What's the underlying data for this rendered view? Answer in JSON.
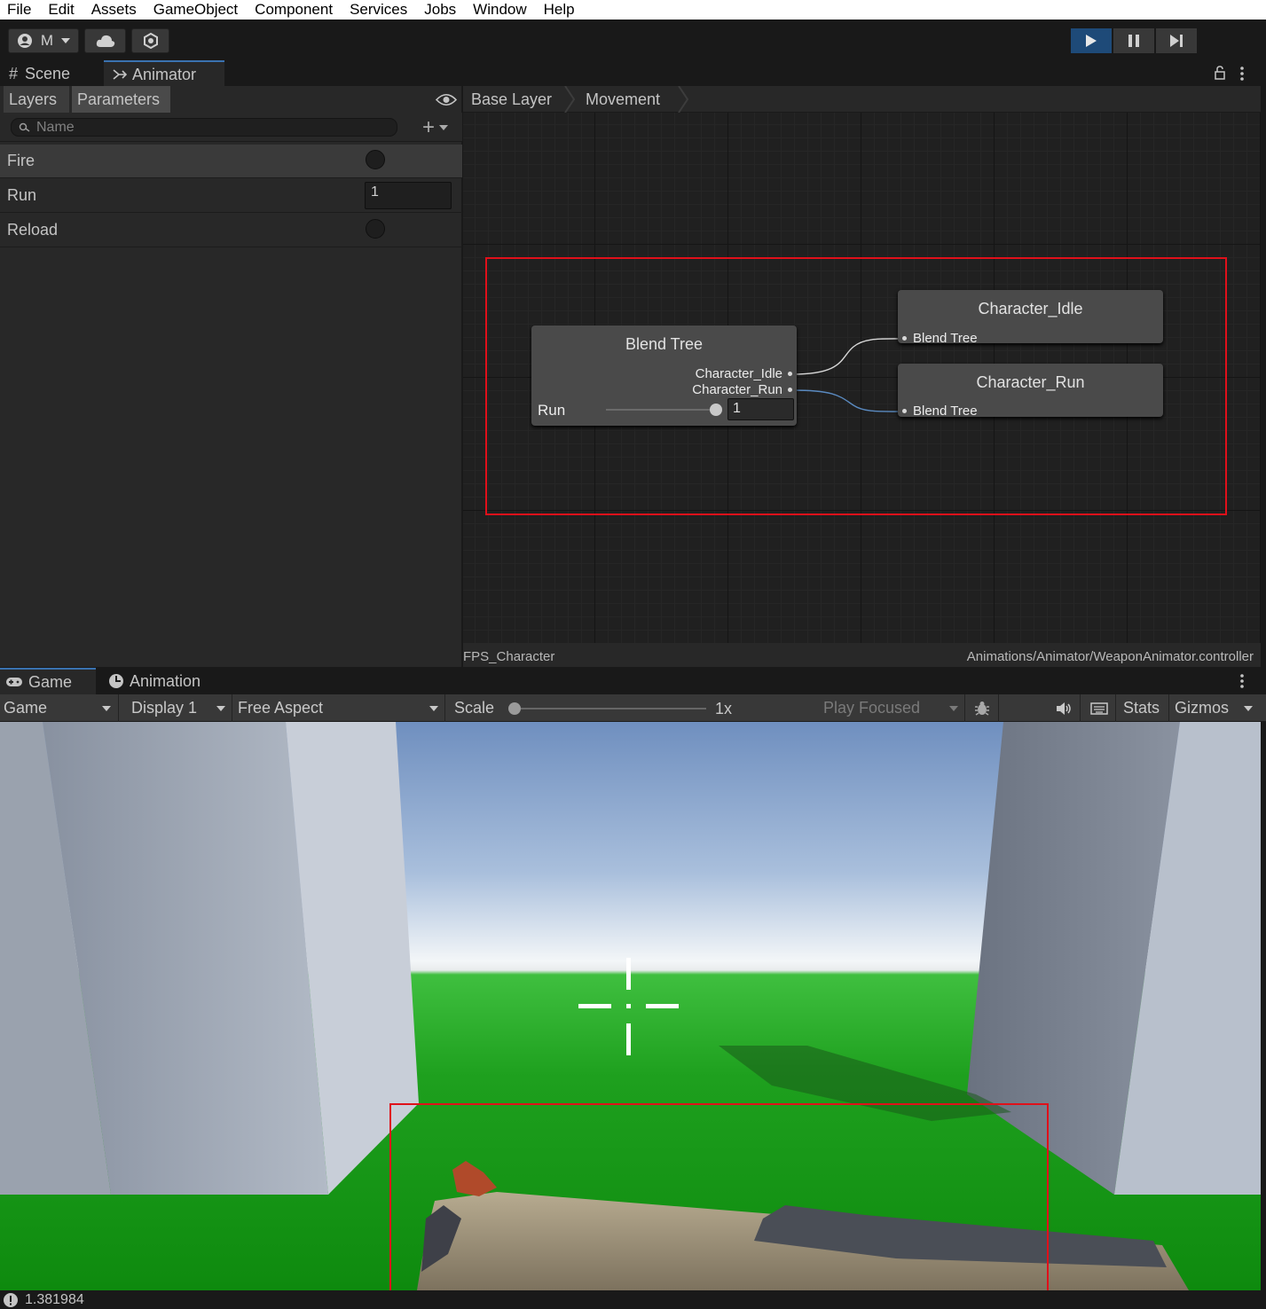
{
  "menu": [
    "File",
    "Edit",
    "Assets",
    "GameObject",
    "Component",
    "Services",
    "Jobs",
    "Window",
    "Help"
  ],
  "toolbar": {
    "account_label": "M"
  },
  "top_tabs": {
    "scene": "Scene",
    "animator": "Animator"
  },
  "animator": {
    "subtabs": {
      "layers": "Layers",
      "parameters": "Parameters"
    },
    "search_placeholder": "Name",
    "parameters": [
      {
        "name": "Fire",
        "type": "trigger"
      },
      {
        "name": "Run",
        "type": "float",
        "value": "1"
      },
      {
        "name": "Reload",
        "type": "trigger"
      }
    ],
    "breadcrumbs": [
      "Base Layer",
      "Movement"
    ],
    "blend_tree": {
      "title": "Blend Tree",
      "motions": [
        "Character_Idle",
        "Character_Run"
      ],
      "param_label": "Run",
      "param_value": "1",
      "slider_fraction": 1.0
    },
    "motion_nodes": [
      {
        "title": "Character_Idle",
        "input": "Blend Tree"
      },
      {
        "title": "Character_Run",
        "input": "Blend Tree"
      }
    ],
    "footer_left": "FPS_Character",
    "footer_right": "Animations/Animator/WeaponAnimator.controller"
  },
  "bottom_tabs": {
    "game": "Game",
    "animation": "Animation"
  },
  "game_toolbar": {
    "mode": "Game",
    "display": "Display 1",
    "aspect": "Free Aspect",
    "scale_label": "Scale",
    "scale_value": "1x",
    "play_focused": "Play Focused",
    "stats": "Stats",
    "gizmos": "Gizmos"
  },
  "status": {
    "message": "1.381984"
  },
  "colors": {
    "highlight_box": "#e0101a",
    "play_active": "#1e4a78",
    "accent": "#3a72b0"
  }
}
